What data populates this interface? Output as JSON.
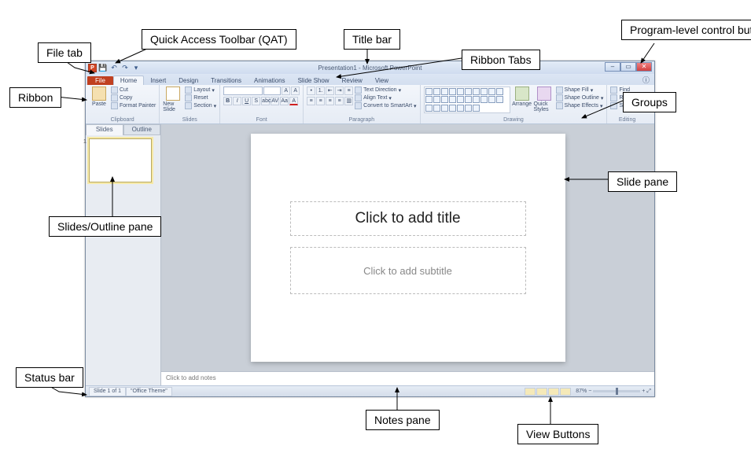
{
  "annotations": {
    "qat": "Quick Access Toolbar (QAT)",
    "title_bar": "Title bar",
    "program_controls": "Program-level control buttons",
    "file_tab": "File tab",
    "ribbon": "Ribbon",
    "ribbon_tabs": "Ribbon Tabs",
    "groups": "Groups",
    "slides_outline_pane": "Slides/Outline pane",
    "slide_pane": "Slide pane",
    "status_bar": "Status bar",
    "notes_pane": "Notes pane",
    "view_buttons": "View Buttons"
  },
  "titlebar": {
    "app_icon_letter": "P",
    "document_title": "Presentation1 - Microsoft PowerPoint"
  },
  "ribbon_tabs": {
    "file": "File",
    "items": [
      "Home",
      "Insert",
      "Design",
      "Transitions",
      "Animations",
      "Slide Show",
      "Review",
      "View"
    ]
  },
  "groups": {
    "clipboard": {
      "label": "Clipboard",
      "paste": "Paste",
      "cut": "Cut",
      "copy": "Copy",
      "format_painter": "Format Painter"
    },
    "slides": {
      "label": "Slides",
      "new_slide": "New Slide",
      "layout": "Layout",
      "reset": "Reset",
      "section": "Section"
    },
    "font": {
      "label": "Font"
    },
    "paragraph": {
      "label": "Paragraph",
      "text_direction": "Text Direction",
      "align_text": "Align Text",
      "convert_smartart": "Convert to SmartArt"
    },
    "drawing": {
      "label": "Drawing",
      "arrange": "Arrange",
      "quick_styles": "Quick Styles",
      "shape_fill": "Shape Fill",
      "shape_outline": "Shape Outline",
      "shape_effects": "Shape Effects"
    },
    "editing": {
      "label": "Editing",
      "find": "Find",
      "replace": "Replace",
      "select": "Select"
    }
  },
  "left_pane": {
    "tab_slides": "Slides",
    "tab_outline": "Outline",
    "thumb_number": "1"
  },
  "slide": {
    "title_placeholder": "Click to add title",
    "subtitle_placeholder": "Click to add subtitle"
  },
  "notes": {
    "placeholder": "Click to add notes"
  },
  "statusbar": {
    "slide_of": "Slide 1 of 1",
    "theme": "\"Office Theme\"",
    "zoom_pct": "87%"
  }
}
